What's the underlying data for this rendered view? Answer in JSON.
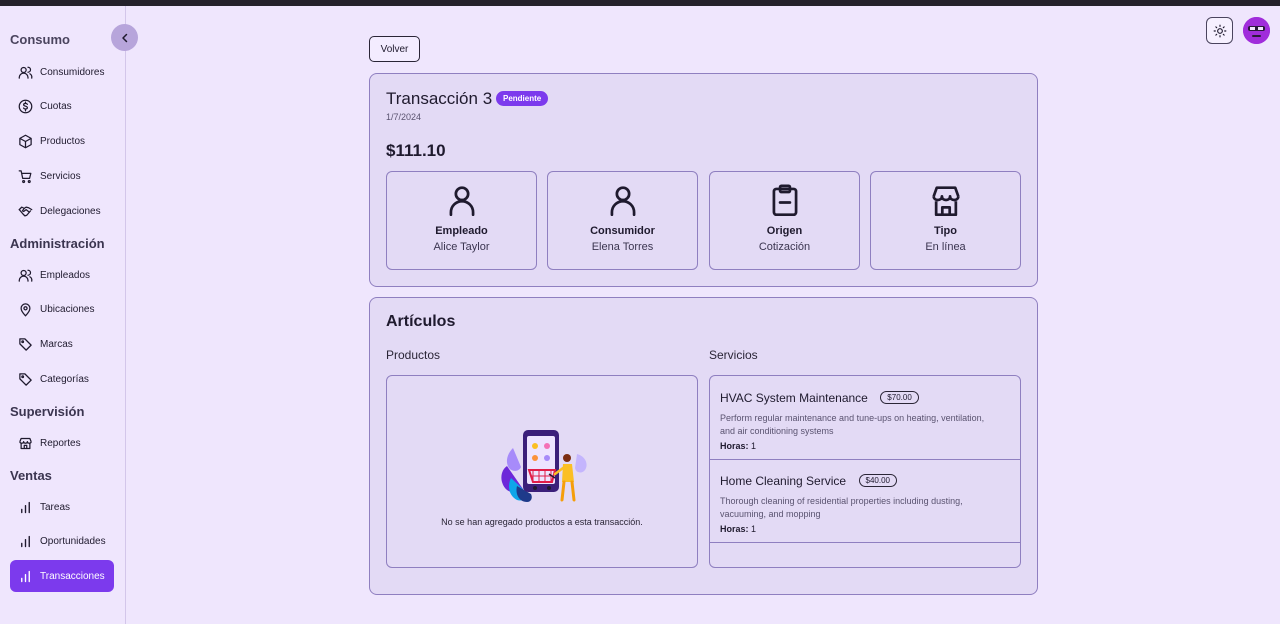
{
  "sidebar": {
    "clipped_section": "Consumo",
    "items_top": [
      {
        "label": "Consumidores",
        "icon": "users-icon"
      },
      {
        "label": "Cuotas",
        "icon": "dollar-circle-icon"
      },
      {
        "label": "Productos",
        "icon": "box-icon"
      },
      {
        "label": "Servicios",
        "icon": "cart-icon"
      },
      {
        "label": "Delegaciones",
        "icon": "handshake-icon"
      }
    ],
    "sections": {
      "administracion": "Administración",
      "supervision": "Supervisión",
      "ventas": "Ventas"
    },
    "items_admin": [
      {
        "label": "Empleados",
        "icon": "users-icon"
      },
      {
        "label": "Ubicaciones",
        "icon": "map-pin-icon"
      },
      {
        "label": "Marcas",
        "icon": "tag-icon"
      },
      {
        "label": "Categorías",
        "icon": "tag-icon"
      }
    ],
    "items_supervision": [
      {
        "label": "Reportes",
        "icon": "store-icon"
      }
    ],
    "items_ventas": [
      {
        "label": "Tareas",
        "icon": "bar-chart-icon"
      },
      {
        "label": "Oportunidades",
        "icon": "bar-chart-icon"
      },
      {
        "label": "Transacciones",
        "icon": "bar-chart-icon",
        "active": true
      }
    ]
  },
  "back_label": "Volver",
  "transaction": {
    "title": "Transacción 3",
    "status": "Pendiente",
    "date": "1/7/2024",
    "amount": "$111.10",
    "info": [
      {
        "label": "Empleado",
        "value": "Alice Taylor",
        "icon": "user-icon"
      },
      {
        "label": "Consumidor",
        "value": "Elena Torres",
        "icon": "user-icon"
      },
      {
        "label": "Origen",
        "value": "Cotización",
        "icon": "clipboard-icon"
      },
      {
        "label": "Tipo",
        "value": "En línea",
        "icon": "store-icon"
      }
    ]
  },
  "articles": {
    "title": "Artículos",
    "products_heading": "Productos",
    "services_heading": "Servicios",
    "empty_products": "No se han agregado productos a esta transacción.",
    "services": [
      {
        "name": "HVAC System Maintenance",
        "price": "$70.00",
        "description": "Perform regular maintenance and tune-ups on heating, ventilation, and air conditioning systems",
        "hours_label": "Horas:",
        "hours": "1"
      },
      {
        "name": "Home Cleaning Service",
        "price": "$40.00",
        "description": "Thorough cleaning of residential properties including dusting, vacuuming, and mopping",
        "hours_label": "Horas:",
        "hours": "1"
      }
    ]
  },
  "colors": {
    "accent": "#7c3aed",
    "background": "#efe6fd",
    "card": "#e3daf5",
    "border": "#8f7fc0"
  }
}
